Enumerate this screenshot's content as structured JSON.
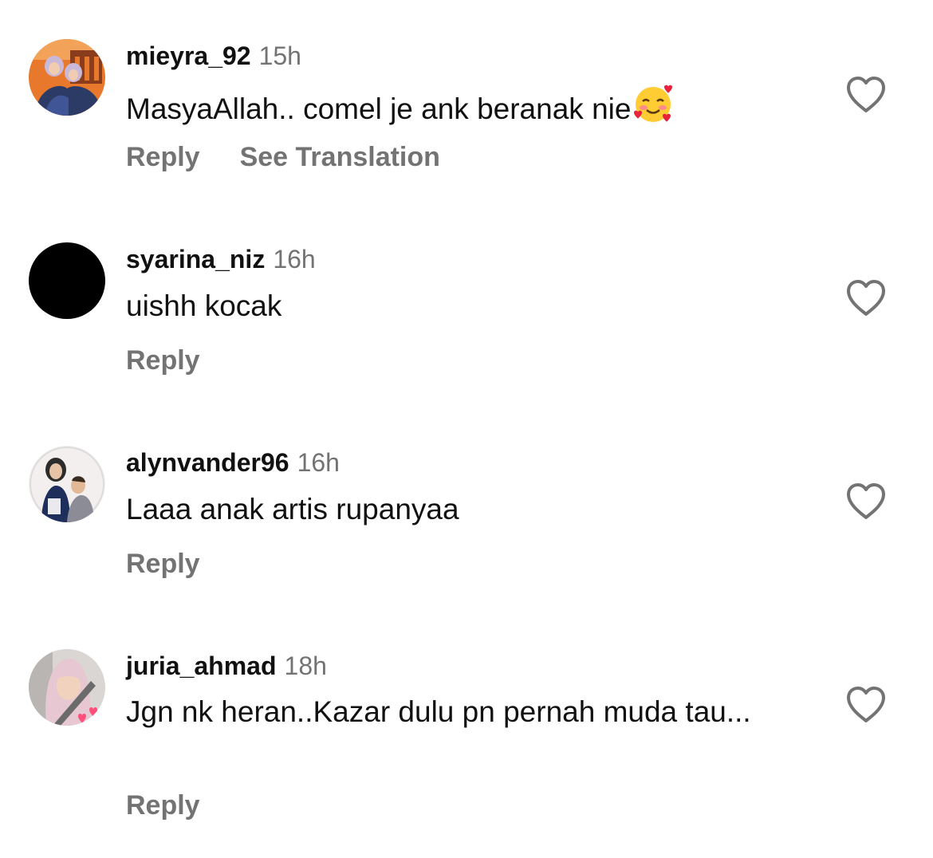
{
  "comments": [
    {
      "username": "mieyra_92",
      "time": "15h",
      "text": "MasyaAllah.. comel je ank beranak nie",
      "emoji": "smiling-face-with-hearts",
      "actions": {
        "reply": "Reply",
        "translate": "See Translation"
      }
    },
    {
      "username": "syarina_niz",
      "time": "16h",
      "text": "uishh kocak",
      "actions": {
        "reply": "Reply"
      }
    },
    {
      "username": "alynvander96",
      "time": "16h",
      "text": "Laaa anak artis rupanyaa",
      "actions": {
        "reply": "Reply"
      }
    },
    {
      "username": "juria_ahmad",
      "time": "18h",
      "text": "Jgn nk heran..Kazar dulu pn pernah muda tau...",
      "actions": {
        "reply": "Reply"
      }
    }
  ],
  "colors": {
    "text": "#111111",
    "secondary": "#737373",
    "background": "#ffffff"
  },
  "icons": {
    "like": "heart-outline-icon"
  }
}
